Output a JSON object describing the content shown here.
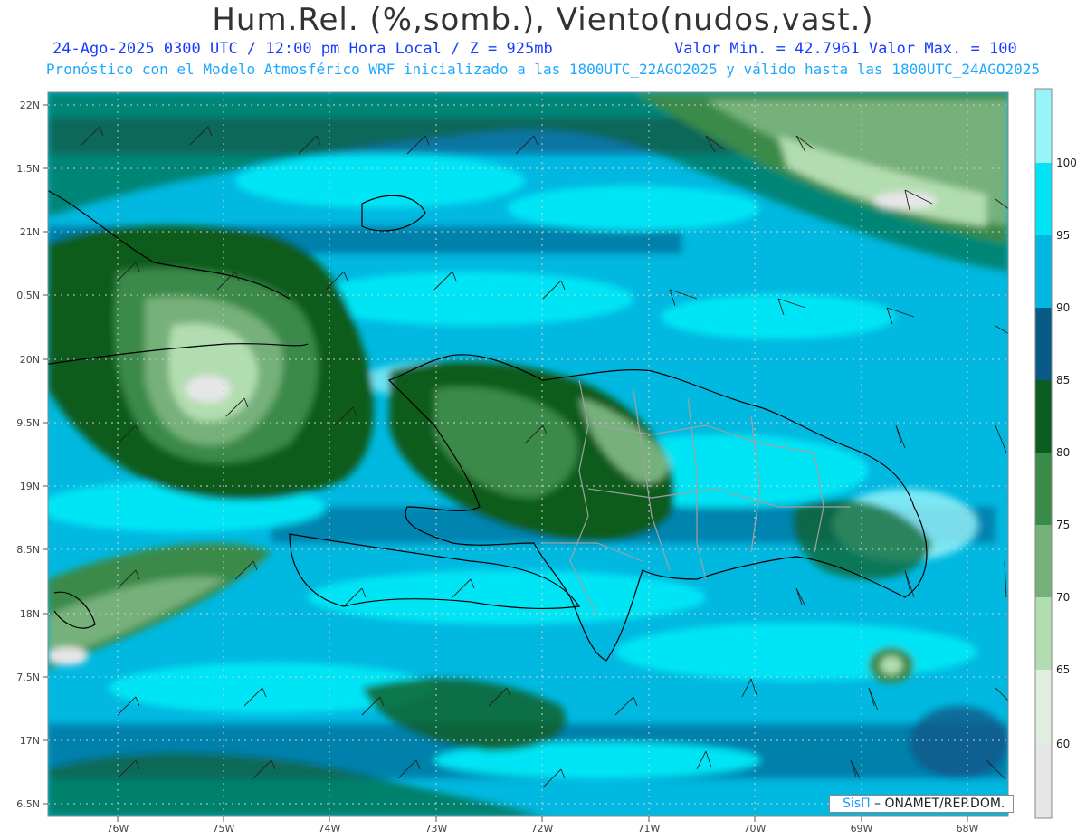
{
  "header": {
    "title": "Hum.Rel. (%,somb.), Viento(nudos,vast.)",
    "line1_left": "24-Ago-2025 0300 UTC / 12:00 pm Hora Local / Z = 925mb",
    "line1_right": "Valor Min. = 42.7961 Valor Max. = 100",
    "line2": "Pronóstico con el Modelo Atmosférico WRF inicializado a las 1800UTC_22AGO2025 y válido hasta las 1800UTC_24AGO2025"
  },
  "axes": {
    "x_labels": [
      "76W",
      "75W",
      "74W",
      "73W",
      "72W",
      "71W",
      "70W",
      "69W",
      "68W"
    ],
    "y_labels": [
      "22N",
      "1.5N",
      "21N",
      "0.5N",
      "20N",
      "9.5N",
      "19N",
      "8.5N",
      "18N",
      "7.5N",
      "17N",
      "6.5N"
    ]
  },
  "colorbar": {
    "ticks": [
      "100",
      "95",
      "90",
      "85",
      "80",
      "75",
      "70",
      "65",
      "60"
    ],
    "colors": [
      "#99f4f9",
      "#00e5f5",
      "#00b8e0",
      "#0a5a88",
      "#0a5c1f",
      "#3a8a48",
      "#76b07a",
      "#b2ddb0",
      "#e0eee0",
      "#e6e6e6"
    ]
  },
  "credit": {
    "brand": "SisΠ",
    "text": " – ONAMET/REP.DOM."
  }
}
